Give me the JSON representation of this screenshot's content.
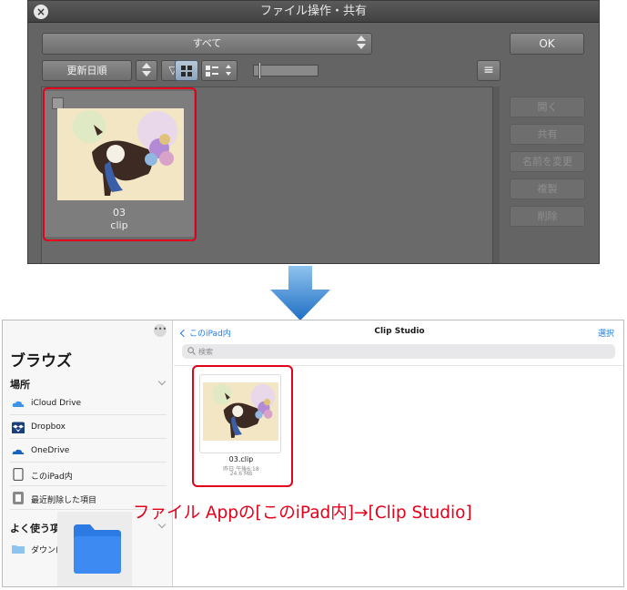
{
  "dialog": {
    "title": "ファイル操作・共有",
    "filter_value": "すべて",
    "ok_label": "OK",
    "sort_value": "更新日順",
    "sort_dir_icon": "▽",
    "menu_icon": "≡",
    "file": {
      "name": "03",
      "extension": "clip"
    },
    "side_buttons": [
      "開く",
      "共有",
      "名前を変更",
      "複製",
      "削除"
    ]
  },
  "files_app": {
    "sidebar": {
      "title": "ブラウズ",
      "places_header": "場所",
      "locations": [
        {
          "label": "iCloud Drive",
          "icon": "icloud-icon"
        },
        {
          "label": "Dropbox",
          "icon": "dropbox-icon"
        },
        {
          "label": "OneDrive",
          "icon": "onedrive-icon"
        },
        {
          "label": "このiPad内",
          "icon": "ipad-icon"
        },
        {
          "label": "最近削除した項目",
          "icon": "trash-icon"
        }
      ],
      "favorites_header": "よく使う項",
      "favorite_item": "ダウンロ"
    },
    "nav": {
      "back_label": "このiPad内",
      "title": "Clip Studio",
      "select_label": "選択"
    },
    "search_placeholder": "検索",
    "file": {
      "name": "03.clip",
      "date": "昨日 午後6:18",
      "size": "24.6 MB"
    }
  },
  "caption": "ファイル Appの[このiPad内]→[Clip Studio]",
  "colors": {
    "highlight": "#e3001b",
    "ios_blue": "#1f7cf2",
    "dialog_bg": "#646464"
  }
}
